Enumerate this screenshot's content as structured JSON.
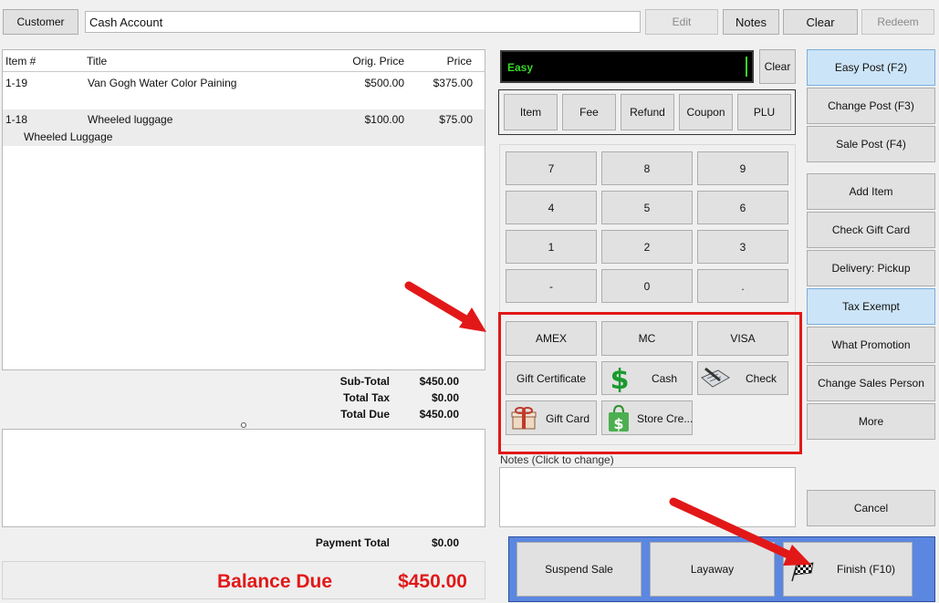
{
  "toolbar": {
    "customer_label": "Customer",
    "customer_value": "Cash Account",
    "edit_label": "Edit",
    "notes_label": "Notes",
    "clear_label": "Clear",
    "redeem_label": "Redeem"
  },
  "items_table": {
    "headers": [
      "Item #",
      "Title",
      "Orig. Price",
      "Price"
    ],
    "rows": [
      {
        "item": "1-19",
        "title": "Van Gogh Water Color Paining",
        "orig": "$500.00",
        "price": "$375.00",
        "sub": ""
      },
      {
        "item": "1-18",
        "title": "Wheeled luggage",
        "orig": "$100.00",
        "price": "$75.00",
        "sub": "Wheeled Luggage"
      }
    ]
  },
  "totals": {
    "subtotal_label": "Sub-Total",
    "subtotal": "$450.00",
    "tax_label": "Total Tax",
    "tax": "$0.00",
    "due_label": "Total Due",
    "due": "$450.00"
  },
  "payment": {
    "total_label": "Payment Total",
    "total": "$0.00",
    "balance_label": "Balance Due",
    "balance": "$450.00"
  },
  "entry": {
    "mode": "Easy",
    "clear_label": "Clear"
  },
  "item_types": [
    "Item",
    "Fee",
    "Refund",
    "Coupon",
    "PLU"
  ],
  "keypad": [
    "7",
    "8",
    "9",
    "4",
    "5",
    "6",
    "1",
    "2",
    "3",
    "-",
    "0",
    "."
  ],
  "tenders": {
    "amex": "AMEX",
    "mc": "MC",
    "visa": "VISA",
    "gift_certificate": "Gift Certificate",
    "cash": "Cash",
    "check": "Check",
    "gift_card": "Gift Card",
    "store_credit": "Store Cre..."
  },
  "notes": {
    "label": "Notes (Click to change)"
  },
  "actions": {
    "easy_post": "Easy Post (F2)",
    "change_post": "Change Post (F3)",
    "sale_post": "Sale Post (F4)",
    "add_item": "Add Item",
    "check_gift_card": "Check Gift Card",
    "delivery": "Delivery: Pickup",
    "tax_exempt": "Tax Exempt",
    "what_promotion": "What Promotion",
    "change_sales_person": "Change Sales Person",
    "more": "More",
    "cancel": "Cancel"
  },
  "finish_bar": {
    "suspend": "Suspend Sale",
    "layaway": "Layaway",
    "finish": "Finish (F10)"
  },
  "colors": {
    "accent_red": "#e21818",
    "highlight_blue": "#cce4f7",
    "mode_text_green": "#39d52a",
    "finish_bar_blue": "#5b87e0"
  }
}
